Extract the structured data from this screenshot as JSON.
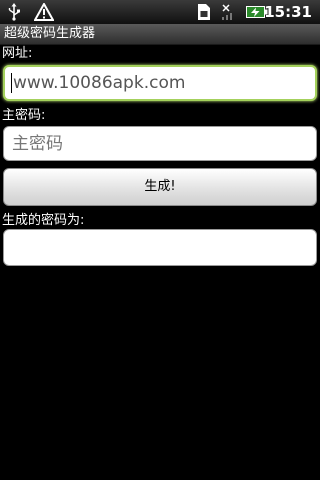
{
  "status_bar": {
    "time": "15:31",
    "icons": [
      "usb-icon",
      "warning-icon",
      "sim-card-icon",
      "no-signal-icon",
      "battery-charging-icon"
    ]
  },
  "app": {
    "title": "超级密码生成器"
  },
  "form": {
    "url_label": "网址:",
    "url_value": "www.10086apk.com",
    "password_label": "主密码:",
    "password_placeholder": "主密码",
    "generate_button": "生成!",
    "result_label": "生成的密码为:",
    "result_value": ""
  },
  "colors": {
    "background": "#000000",
    "focus_border": "#a4d15c",
    "battery_green": "#3fbf3f"
  }
}
